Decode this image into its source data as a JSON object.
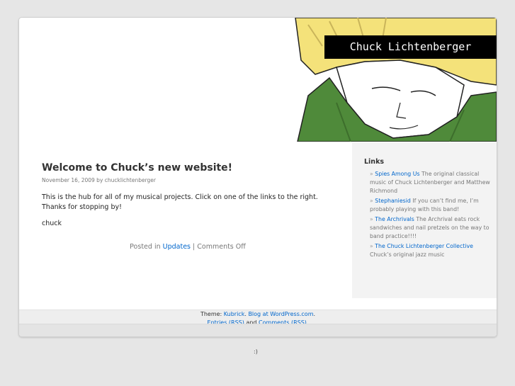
{
  "header": {
    "site_title": "Chuck Lichtenberger"
  },
  "post": {
    "title": "Welcome to Chuck’s new website!",
    "meta": "November 16, 2009 by chucklichtenberger",
    "paragraph_1": "This is the hub for all of my musical projects.  Click on one of the links to the right.  Thanks for stopping by!",
    "paragraph_2": "chuck",
    "posted_in": "Posted in",
    "category": "Updates",
    "separator": "|",
    "comments": "Comments Off"
  },
  "sidebar": {
    "heading": "Links",
    "bullet": "»",
    "items": [
      {
        "link": "Spies Among Us",
        "desc": "The original classical music of Chuck Lichtenberger and Matthew Richmond"
      },
      {
        "link": "Stephaniesid",
        "desc": "If you can’t find me, I’m probably playing with this band!"
      },
      {
        "link": "The Archrivals",
        "desc": "The Archrival eats rock sandwiches and nail pretzels on the way to band practice!!!!"
      },
      {
        "link": "The Chuck Lichtenberger Collective",
        "desc": "Chuck’s original jazz music"
      }
    ]
  },
  "footer": {
    "theme_label": "Theme:",
    "theme_link": "Kubrick",
    "blog_link": "Blog at WordPress.com",
    "entries_link": "Entries (RSS)",
    "and_text": "and",
    "comments_link": "Comments (RSS)"
  },
  "stats": {
    "smiley": ":)"
  },
  "colors": {
    "link": "#0066cc",
    "background": "#e6e6e6",
    "sidebar": "#f3f3f3",
    "shirt": "#4f8a3a",
    "hair": "#f4e27a"
  }
}
